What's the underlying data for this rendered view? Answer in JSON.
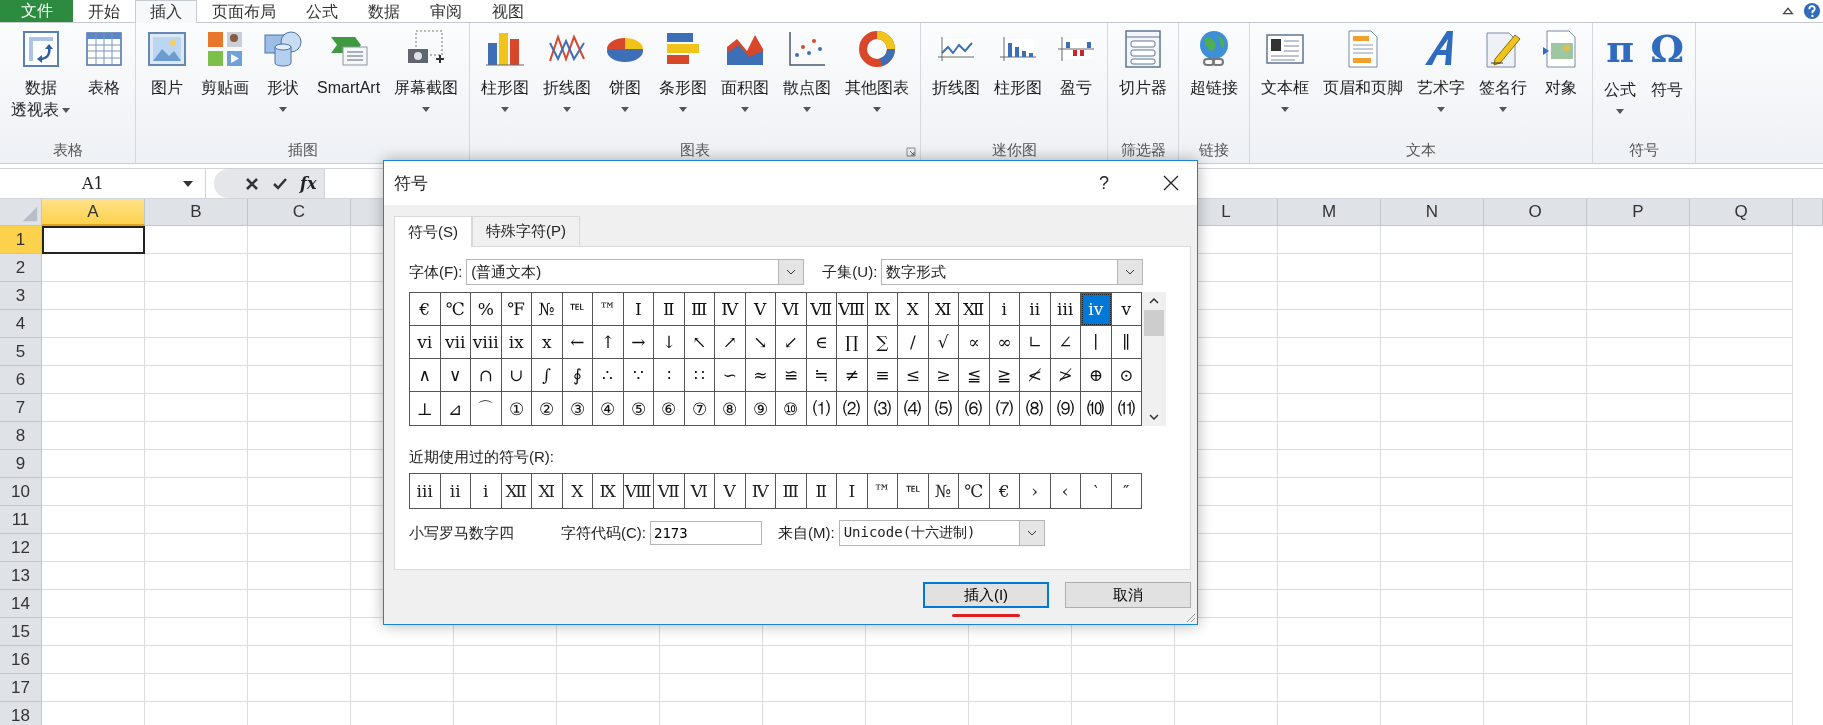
{
  "ribbon": {
    "tabs": [
      {
        "label": "文件",
        "kind": "file",
        "selected": false
      },
      {
        "label": "开始",
        "kind": "tab",
        "selected": false
      },
      {
        "label": "插入",
        "kind": "tab",
        "selected": true
      },
      {
        "label": "页面布局",
        "kind": "tab",
        "selected": false
      },
      {
        "label": "公式",
        "kind": "tab",
        "selected": false
      },
      {
        "label": "数据",
        "kind": "tab",
        "selected": false
      },
      {
        "label": "审阅",
        "kind": "tab",
        "selected": false
      },
      {
        "label": "视图",
        "kind": "tab",
        "selected": false
      }
    ],
    "groups": [
      {
        "label": "表格",
        "launcher": false,
        "buttons": [
          {
            "lines": [
              "数据",
              "透视表"
            ],
            "dropdown": true
          },
          {
            "label": "表格",
            "dropdown": false
          }
        ]
      },
      {
        "label": "插图",
        "launcher": false,
        "buttons": [
          {
            "label": "图片",
            "dropdown": false
          },
          {
            "label": "剪贴画",
            "dropdown": false
          },
          {
            "label": "形状",
            "dropdown": true
          },
          {
            "label": "SmartArt",
            "dropdown": false
          },
          {
            "label": "屏幕截图",
            "dropdown": true
          }
        ]
      },
      {
        "label": "图表",
        "launcher": true,
        "buttons": [
          {
            "label": "柱形图",
            "dropdown": true
          },
          {
            "label": "折线图",
            "dropdown": true
          },
          {
            "label": "饼图",
            "dropdown": true
          },
          {
            "label": "条形图",
            "dropdown": true
          },
          {
            "label": "面积图",
            "dropdown": true
          },
          {
            "label": "散点图",
            "dropdown": true
          },
          {
            "label": "其他图表",
            "dropdown": true
          }
        ]
      },
      {
        "label": "迷你图",
        "launcher": false,
        "buttons": [
          {
            "label": "折线图",
            "dropdown": false
          },
          {
            "label": "柱形图",
            "dropdown": false
          },
          {
            "label": "盈亏",
            "dropdown": false
          }
        ]
      },
      {
        "label": "筛选器",
        "launcher": false,
        "buttons": [
          {
            "label": "切片器",
            "dropdown": false
          }
        ]
      },
      {
        "label": "链接",
        "launcher": false,
        "buttons": [
          {
            "label": "超链接",
            "dropdown": false
          }
        ]
      },
      {
        "label": "文本",
        "launcher": false,
        "buttons": [
          {
            "label": "文本框",
            "dropdown": true
          },
          {
            "label": "页眉和页脚",
            "dropdown": false
          },
          {
            "label": "艺术字",
            "dropdown": true
          },
          {
            "label": "签名行",
            "dropdown": true
          },
          {
            "label": "对象",
            "dropdown": false
          }
        ]
      },
      {
        "label": "符号",
        "launcher": false,
        "buttons": [
          {
            "label": "公式",
            "dropdown": true,
            "glyph": "π"
          },
          {
            "label": "符号",
            "dropdown": false,
            "glyph": "Ω"
          }
        ]
      }
    ]
  },
  "formula_bar": {
    "name_box": "A1",
    "function_button": "fx"
  },
  "sheet": {
    "columns_left": [
      {
        "label": "A",
        "selected": true
      },
      {
        "label": "B",
        "selected": false
      },
      {
        "label": "C",
        "selected": false
      }
    ],
    "columns_right": [
      {
        "label": "L",
        "selected": false
      },
      {
        "label": "M",
        "selected": false
      },
      {
        "label": "N",
        "selected": false
      },
      {
        "label": "O",
        "selected": false
      },
      {
        "label": "P",
        "selected": false
      },
      {
        "label": "Q",
        "selected": false
      }
    ],
    "rows": [
      {
        "label": "1",
        "selected": true
      },
      {
        "label": "2",
        "selected": false
      },
      {
        "label": "3",
        "selected": false
      },
      {
        "label": "4",
        "selected": false
      },
      {
        "label": "5",
        "selected": false
      },
      {
        "label": "6",
        "selected": false
      },
      {
        "label": "7",
        "selected": false
      },
      {
        "label": "8",
        "selected": false
      },
      {
        "label": "9",
        "selected": false
      },
      {
        "label": "10",
        "selected": false
      },
      {
        "label": "11",
        "selected": false
      },
      {
        "label": "12",
        "selected": false
      },
      {
        "label": "13",
        "selected": false
      },
      {
        "label": "14",
        "selected": false
      },
      {
        "label": "15",
        "selected": false
      },
      {
        "label": "16",
        "selected": false
      },
      {
        "label": "17",
        "selected": false
      },
      {
        "label": "18",
        "selected": false
      }
    ]
  },
  "dialog": {
    "title": "符号",
    "help": "?",
    "tabs": [
      {
        "label": "符号(S)",
        "selected": true
      },
      {
        "label": "特殊字符(P)",
        "selected": false
      }
    ],
    "font_label": "字体(F):",
    "font_value": "(普通文本)",
    "subset_label": "子集(U):",
    "subset_value": "数字形式",
    "symbols": [
      {
        "char": "€",
        "selected": false
      },
      {
        "char": "℃",
        "selected": false
      },
      {
        "char": "%",
        "selected": false
      },
      {
        "char": "℉",
        "selected": false
      },
      {
        "char": "№",
        "selected": false
      },
      {
        "char": "℡",
        "selected": false
      },
      {
        "char": "™",
        "selected": false
      },
      {
        "char": "Ⅰ",
        "selected": false
      },
      {
        "char": "Ⅱ",
        "selected": false
      },
      {
        "char": "Ⅲ",
        "selected": false
      },
      {
        "char": "Ⅳ",
        "selected": false
      },
      {
        "char": "Ⅴ",
        "selected": false
      },
      {
        "char": "Ⅵ",
        "selected": false
      },
      {
        "char": "Ⅶ",
        "selected": false
      },
      {
        "char": "Ⅷ",
        "selected": false
      },
      {
        "char": "Ⅸ",
        "selected": false
      },
      {
        "char": "Ⅹ",
        "selected": false
      },
      {
        "char": "Ⅺ",
        "selected": false
      },
      {
        "char": "Ⅻ",
        "selected": false
      },
      {
        "char": "ⅰ",
        "selected": false
      },
      {
        "char": "ⅱ",
        "selected": false
      },
      {
        "char": "ⅲ",
        "selected": false
      },
      {
        "char": "ⅳ",
        "selected": true
      },
      {
        "char": "ⅴ",
        "selected": false
      },
      {
        "char": "ⅵ",
        "selected": false
      },
      {
        "char": "ⅶ",
        "selected": false
      },
      {
        "char": "ⅷ",
        "selected": false
      },
      {
        "char": "ⅸ",
        "selected": false
      },
      {
        "char": "ⅹ",
        "selected": false
      },
      {
        "char": "←",
        "selected": false
      },
      {
        "char": "↑",
        "selected": false
      },
      {
        "char": "→",
        "selected": false
      },
      {
        "char": "↓",
        "selected": false
      },
      {
        "char": "↖",
        "selected": false
      },
      {
        "char": "↗",
        "selected": false
      },
      {
        "char": "↘",
        "selected": false
      },
      {
        "char": "↙",
        "selected": false
      },
      {
        "char": "∈",
        "selected": false
      },
      {
        "char": "∏",
        "selected": false
      },
      {
        "char": "∑",
        "selected": false
      },
      {
        "char": "∕",
        "selected": false
      },
      {
        "char": "√",
        "selected": false
      },
      {
        "char": "∝",
        "selected": false
      },
      {
        "char": "∞",
        "selected": false
      },
      {
        "char": "∟",
        "selected": false
      },
      {
        "char": "∠",
        "selected": false
      },
      {
        "char": "∣",
        "selected": false
      },
      {
        "char": "∥",
        "selected": false
      },
      {
        "char": "∧",
        "selected": false
      },
      {
        "char": "∨",
        "selected": false
      },
      {
        "char": "∩",
        "selected": false
      },
      {
        "char": "∪",
        "selected": false
      },
      {
        "char": "∫",
        "selected": false
      },
      {
        "char": "∮",
        "selected": false
      },
      {
        "char": "∴",
        "selected": false
      },
      {
        "char": "∵",
        "selected": false
      },
      {
        "char": "∶",
        "selected": false
      },
      {
        "char": "∷",
        "selected": false
      },
      {
        "char": "∽",
        "selected": false
      },
      {
        "char": "≈",
        "selected": false
      },
      {
        "char": "≌",
        "selected": false
      },
      {
        "char": "≒",
        "selected": false
      },
      {
        "char": "≠",
        "selected": false
      },
      {
        "char": "≡",
        "selected": false
      },
      {
        "char": "≤",
        "selected": false
      },
      {
        "char": "≥",
        "selected": false
      },
      {
        "char": "≦",
        "selected": false
      },
      {
        "char": "≧",
        "selected": false
      },
      {
        "char": "≮",
        "selected": false
      },
      {
        "char": "≯",
        "selected": false
      },
      {
        "char": "⊕",
        "selected": false
      },
      {
        "char": "⊙",
        "selected": false
      },
      {
        "char": "⊥",
        "selected": false
      },
      {
        "char": "⊿",
        "selected": false
      },
      {
        "char": "⌒",
        "selected": false
      },
      {
        "char": "①",
        "selected": false
      },
      {
        "char": "②",
        "selected": false
      },
      {
        "char": "③",
        "selected": false
      },
      {
        "char": "④",
        "selected": false
      },
      {
        "char": "⑤",
        "selected": false
      },
      {
        "char": "⑥",
        "selected": false
      },
      {
        "char": "⑦",
        "selected": false
      },
      {
        "char": "⑧",
        "selected": false
      },
      {
        "char": "⑨",
        "selected": false
      },
      {
        "char": "⑩",
        "selected": false
      },
      {
        "char": "⑴",
        "selected": false
      },
      {
        "char": "⑵",
        "selected": false
      },
      {
        "char": "⑶",
        "selected": false
      },
      {
        "char": "⑷",
        "selected": false
      },
      {
        "char": "⑸",
        "selected": false
      },
      {
        "char": "⑹",
        "selected": false
      },
      {
        "char": "⑺",
        "selected": false
      },
      {
        "char": "⑻",
        "selected": false
      },
      {
        "char": "⑼",
        "selected": false
      },
      {
        "char": "⑽",
        "selected": false
      },
      {
        "char": "⑾",
        "selected": false
      }
    ],
    "recent_label": "近期使用过的符号(R):",
    "recent": [
      "ⅲ",
      "ⅱ",
      "ⅰ",
      "Ⅻ",
      "Ⅺ",
      "Ⅹ",
      "Ⅸ",
      "Ⅷ",
      "Ⅶ",
      "Ⅵ",
      "Ⅴ",
      "Ⅳ",
      "Ⅲ",
      "Ⅱ",
      "Ⅰ",
      "™",
      "℡",
      "№",
      "℃",
      "€",
      "›",
      "‹",
      "‵",
      "″"
    ],
    "symbol_name": "小写罗马数字四",
    "code_label": "字符代码(C):",
    "code_value": "2173",
    "from_label": "来自(M):",
    "from_value": "Unicode(十六进制)",
    "buttons": [
      {
        "label": "插入(I)",
        "kind": "default"
      },
      {
        "label": "取消",
        "kind": "normal"
      }
    ]
  }
}
